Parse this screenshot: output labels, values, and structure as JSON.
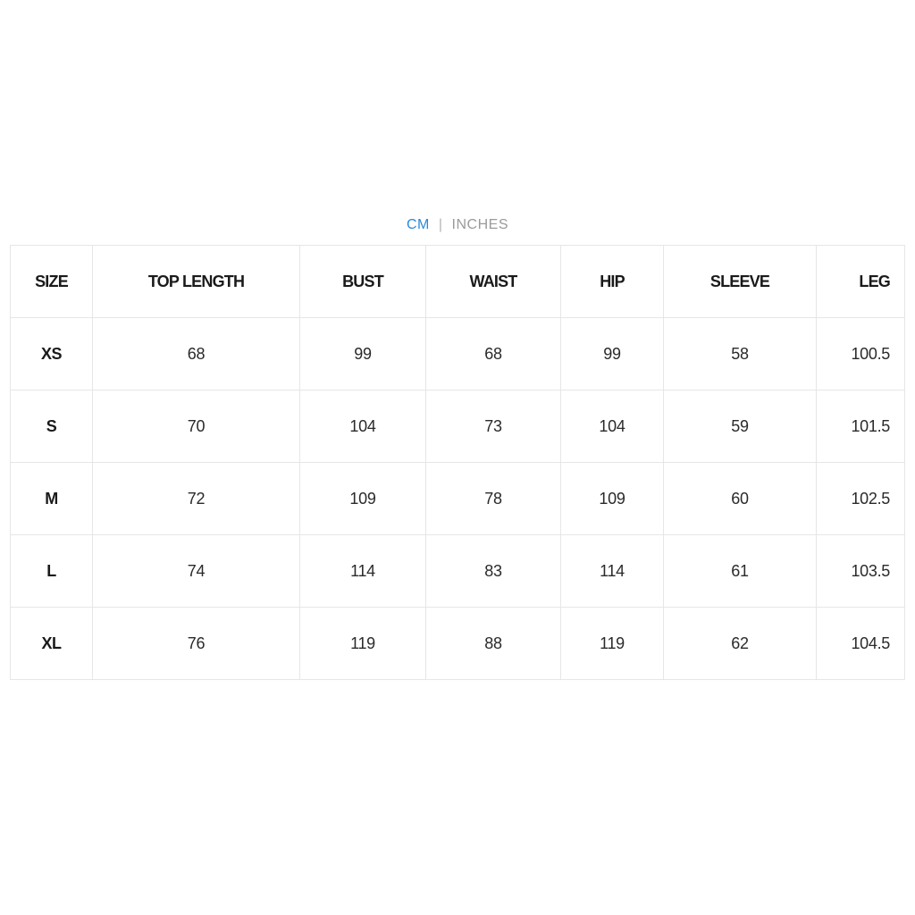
{
  "units": {
    "active": "CM",
    "separator": "|",
    "inactive": "INCHES"
  },
  "table": {
    "headers": [
      "SIZE",
      "TOP LENGTH",
      "BUST",
      "WAIST",
      "HIP",
      "SLEEVE",
      "LEG"
    ],
    "rows": [
      [
        "XS",
        "68",
        "99",
        "68",
        "99",
        "58",
        "100.5"
      ],
      [
        "S",
        "70",
        "104",
        "73",
        "104",
        "59",
        "101.5"
      ],
      [
        "M",
        "72",
        "109",
        "78",
        "109",
        "60",
        "102.5"
      ],
      [
        "L",
        "74",
        "114",
        "83",
        "114",
        "61",
        "103.5"
      ],
      [
        "XL",
        "76",
        "119",
        "88",
        "119",
        "62",
        "104.5"
      ]
    ]
  },
  "colors": {
    "active_unit": "#2a8ad8",
    "inactive_unit": "#9a9a9a",
    "grid": "#e6e6e6"
  }
}
